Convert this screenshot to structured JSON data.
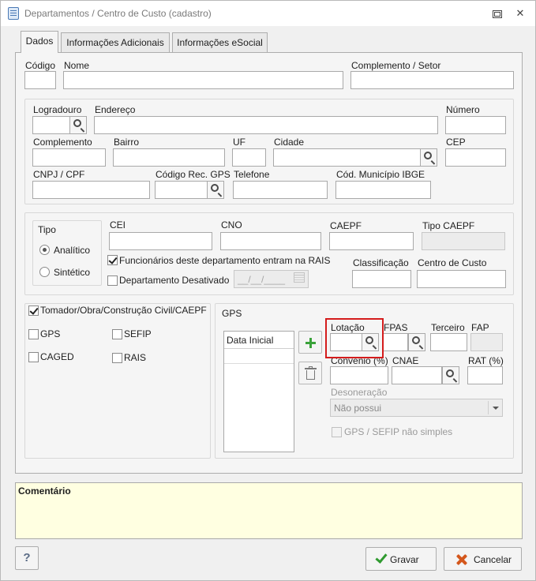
{
  "window": {
    "title": "Departamentos / Centro de Custo (cadastro)"
  },
  "tabs": [
    {
      "label": "Dados"
    },
    {
      "label": "Informações Adicionais"
    },
    {
      "label": "Informações eSocial"
    }
  ],
  "fields": {
    "codigo": {
      "label": "Código",
      "value": ""
    },
    "nome": {
      "label": "Nome",
      "value": ""
    },
    "complemento_setor": {
      "label": "Complemento / Setor",
      "value": ""
    }
  },
  "address": {
    "logradouro": {
      "label": "Logradouro",
      "value": ""
    },
    "endereco": {
      "label": "Endereço",
      "value": ""
    },
    "numero": {
      "label": "Número",
      "value": ""
    },
    "complemento": {
      "label": "Complemento",
      "value": ""
    },
    "bairro": {
      "label": "Bairro",
      "value": ""
    },
    "uf": {
      "label": "UF",
      "value": ""
    },
    "cidade": {
      "label": "Cidade",
      "value": ""
    },
    "cep": {
      "label": "CEP",
      "value": ""
    },
    "cnpj_cpf": {
      "label": "CNPJ / CPF",
      "value": ""
    },
    "codigo_rec_gps": {
      "label": "Código Rec. GPS",
      "value": ""
    },
    "telefone": {
      "label": "Telefone",
      "value": ""
    },
    "cod_municipio_ibge": {
      "label": "Cód. Município IBGE",
      "value": ""
    }
  },
  "tipo": {
    "legend": "Tipo",
    "options": [
      {
        "label": "Analítico",
        "selected": true
      },
      {
        "label": "Sintético",
        "selected": false
      }
    ]
  },
  "registro": {
    "cei": {
      "label": "CEI",
      "value": ""
    },
    "cno": {
      "label": "CNO",
      "value": ""
    },
    "caepf": {
      "label": "CAEPF",
      "value": ""
    },
    "tipo_caepf": {
      "label": "Tipo CAEPF",
      "value": ""
    },
    "rais_checkbox": {
      "label": "Funcionários deste departamento entram na RAIS",
      "checked": true
    },
    "desativado_checkbox": {
      "label": "Departamento Desativado",
      "checked": false
    },
    "data_desativacao": {
      "placeholder": "__/__/____"
    },
    "classificacao": {
      "label": "Classificação",
      "value": ""
    },
    "centro_de_custo": {
      "label": "Centro de Custo",
      "value": ""
    }
  },
  "options": {
    "tomador": {
      "label": "Tomador/Obra/Construção Civil/CAEPF",
      "checked": true
    },
    "gps": {
      "label": "GPS",
      "checked": false
    },
    "sefip": {
      "label": "SEFIP",
      "checked": false
    },
    "caged": {
      "label": "CAGED",
      "checked": false
    },
    "rais": {
      "label": "RAIS",
      "checked": false
    }
  },
  "gps_group": {
    "legend": "GPS",
    "grid_header": "Data Inicial",
    "lotacao": {
      "label": "Lotação",
      "value": ""
    },
    "fpas": {
      "label": "FPAS",
      "value": ""
    },
    "terceiro": {
      "label": "Terceiro",
      "value": ""
    },
    "fap": {
      "label": "FAP",
      "value": ""
    },
    "convenio": {
      "label": "Convênio (%)",
      "value": ""
    },
    "cnae": {
      "label": "CNAE",
      "value": ""
    },
    "rat": {
      "label": "RAT (%)",
      "value": ""
    },
    "desoneracao": {
      "label": "Desoneração",
      "value": "Não possui"
    },
    "gps_sefip_nao_simples": {
      "label": "GPS / SEFIP não simples",
      "checked": false
    }
  },
  "comment": {
    "label": "Comentário"
  },
  "buttons": {
    "help": "?",
    "save": "Gravar",
    "cancel": "Cancelar"
  },
  "colors": {
    "highlight": "#d41c1c",
    "comment_bg": "#ffffe1",
    "add_icon": "#3aa23a",
    "cancel_icon": "#d4571c"
  }
}
